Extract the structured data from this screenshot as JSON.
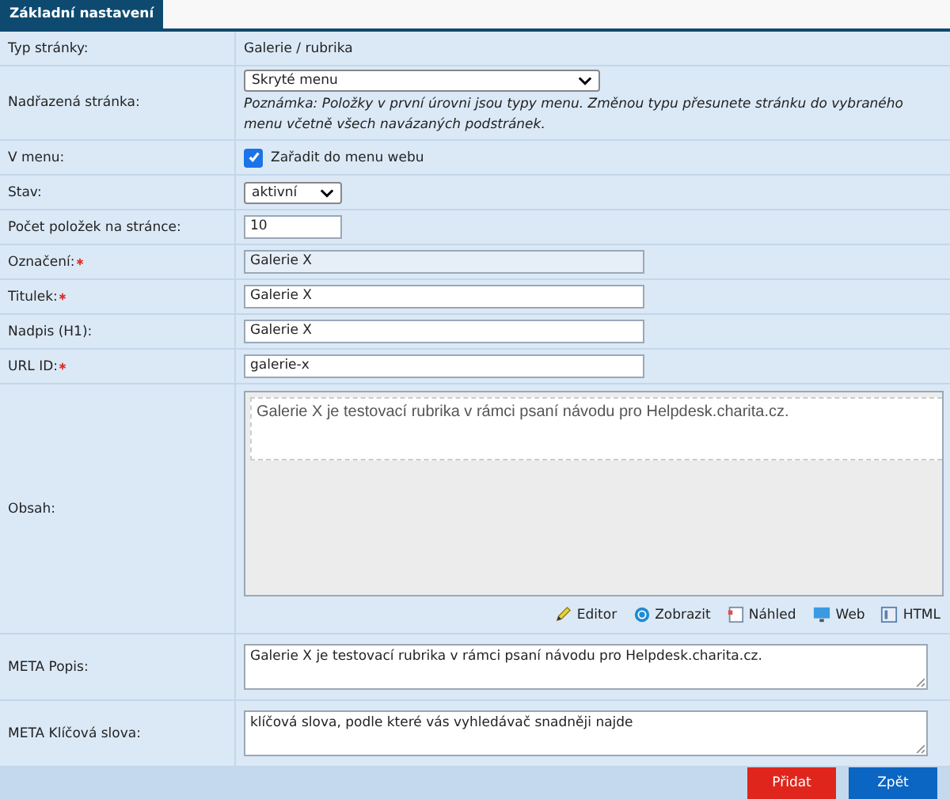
{
  "tab": {
    "label": "Základní nastavení",
    "selected": true
  },
  "rows": [
    {
      "kind": "text",
      "label": "Typ stránky:",
      "required": false,
      "value": "Galerie / rubrika"
    },
    {
      "kind": "select",
      "label": "Nadřazená stránka:",
      "required": false,
      "value": "Skryté menu",
      "note": "Poznámka: Položky v první úrovni jsou typy menu. Změnou typu přesunete stránku do vybraného menu včetně všech navázaných podstránek."
    },
    {
      "kind": "checkbox",
      "label": "V menu:",
      "required": false,
      "checked": true,
      "value": "Zařadit do menu webu"
    },
    {
      "kind": "select",
      "label": "Stav:",
      "required": false,
      "value": "aktivní"
    },
    {
      "kind": "input",
      "label": "Počet položek na stránce:",
      "required": false,
      "value": "10",
      "disabled": false
    },
    {
      "kind": "input",
      "label": "Označení:",
      "required": true,
      "value": "Galerie X",
      "disabled": true
    },
    {
      "kind": "input",
      "label": "Titulek:",
      "required": true,
      "value": "Galerie X",
      "disabled": false
    },
    {
      "kind": "input",
      "label": "Nadpis (H1):",
      "required": false,
      "value": "Galerie X",
      "disabled": false
    },
    {
      "kind": "input",
      "label": "URL ID:",
      "required": true,
      "value": "galerie-x",
      "disabled": false
    },
    {
      "kind": "editor",
      "label": "Obsah:",
      "required": false,
      "value": "Galerie X je testovací rubrika v rámci psaní návodu pro Helpdesk.charita.cz.",
      "tools": [
        {
          "kind": "pencil",
          "label": "Editor"
        },
        {
          "kind": "circle",
          "label": "Zobrazit"
        },
        {
          "kind": "preview",
          "label": "Náhled"
        },
        {
          "kind": "monitor",
          "label": "Web"
        },
        {
          "kind": "html",
          "label": "HTML"
        }
      ]
    },
    {
      "kind": "textarea",
      "label": "META Popis:",
      "required": false,
      "value": "Galerie X je testovací rubrika v rámci psaní návodu pro Helpdesk.charita.cz."
    },
    {
      "kind": "textarea",
      "label": "META Klíčová slova:",
      "required": false,
      "value": "klíčová slova, podle které vás vyhledávač snadněji najde"
    }
  ],
  "buttons": [
    {
      "kind": "primary",
      "label": "Přidat"
    },
    {
      "kind": "secondary",
      "label": "Zpět"
    }
  ]
}
